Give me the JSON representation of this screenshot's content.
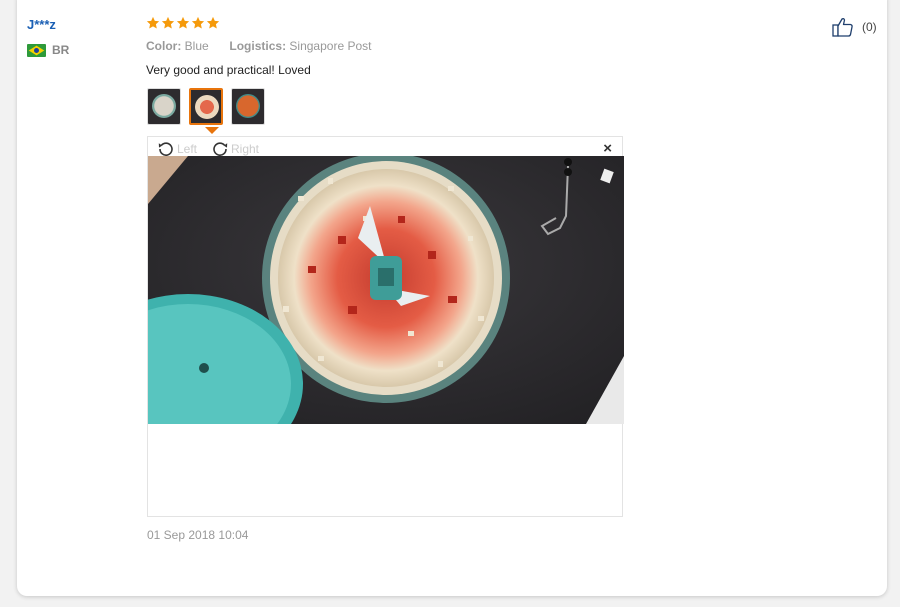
{
  "review": {
    "username": "J***z",
    "country": "BR",
    "rating": 5,
    "color_label": "Color:",
    "color_value": "Blue",
    "logistics_label": "Logistics:",
    "logistics_value": "Singapore Post",
    "text": "Very good and practical! Loved",
    "date": "01 Sep 2018 10:04",
    "helpful_count": "(0)"
  },
  "viewer": {
    "rotate_left": "Left",
    "rotate_right": "Right",
    "close": "×",
    "active_thumb_index": 1
  },
  "colors": {
    "star": "#f59a0b",
    "accent": "#e8740c",
    "username": "#1a5fb4",
    "meta_text": "#999999"
  },
  "icons": {
    "helpful": "thumbs-up-icon",
    "rotate_left": "rotate-left-icon",
    "rotate_right": "rotate-right-icon",
    "close": "close-icon",
    "flag": "brazil-flag-icon",
    "star": "star-icon"
  }
}
